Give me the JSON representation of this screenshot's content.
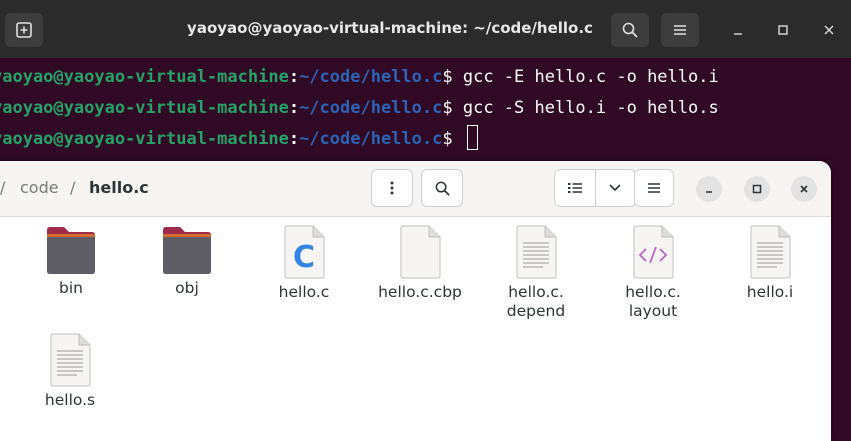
{
  "terminal": {
    "title": "yaoyao@yaoyao-virtual-machine: ~/code/hello.c",
    "lines": [
      {
        "user": "yaoyao@yaoyao-virtual-machine",
        "colon": ":",
        "path": "~/code/hello.c",
        "prompt": "$ ",
        "command": "gcc -E hello.c -o hello.i"
      },
      {
        "user": "yaoyao@yaoyao-virtual-machine",
        "colon": ":",
        "path": "~/code/hello.c",
        "prompt": "$ ",
        "command": "gcc -S hello.i -o hello.s"
      },
      {
        "user": "yaoyao@yaoyao-virtual-machine",
        "colon": ":",
        "path": "~/code/hello.c",
        "prompt": "$ ",
        "command": ""
      }
    ],
    "colors": {
      "background": "#300a24",
      "user": "#26a269",
      "path": "#2d63b6"
    }
  },
  "file_manager": {
    "breadcrumb": {
      "sep1": "/",
      "folder": "code",
      "sep2": "/",
      "current": "hello.c"
    },
    "files": [
      {
        "name": "bin",
        "icon": "folder-icon"
      },
      {
        "name": "obj",
        "icon": "folder-icon"
      },
      {
        "name": "hello.c",
        "icon": "c-source-icon"
      },
      {
        "name": "hello.c.cbp",
        "icon": "blank-file-icon"
      },
      {
        "name": "hello.c.\ndepend",
        "icon": "text-file-icon"
      },
      {
        "name": "hello.c.\nlayout",
        "icon": "xml-file-icon"
      },
      {
        "name": "hello.i",
        "icon": "text-file-icon"
      },
      {
        "name": "hello.s",
        "icon": "text-file-icon"
      }
    ]
  }
}
